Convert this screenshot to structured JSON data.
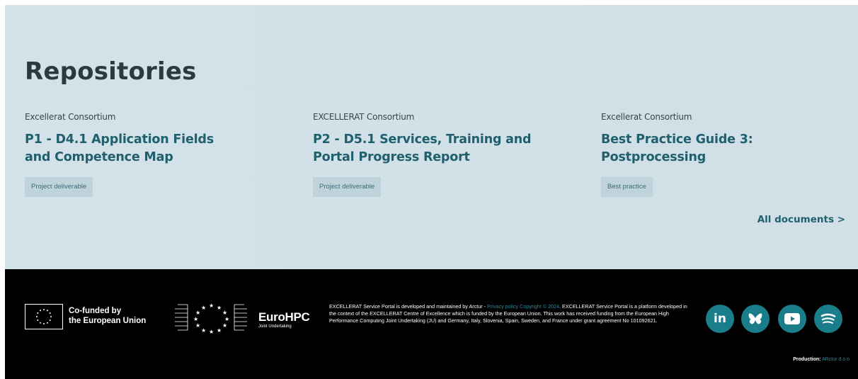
{
  "repositories": {
    "title": "Repositories",
    "cards": [
      {
        "author": "Excellerat Consortium",
        "title": "P1 - D4.1 Application Fields and Competence Map",
        "tag": "Project deliverable"
      },
      {
        "author": "EXCELLERAT Consortium",
        "title": "P2 - D5.1 Services, Training and Portal Progress Report",
        "tag": "Project deliverable"
      },
      {
        "author": "Excellerat Consortium",
        "title": "Best Practice Guide 3: Postprocessing",
        "tag": "Best practice"
      }
    ],
    "all_documents_label": "All documents",
    "all_documents_chevron": ">"
  },
  "footer": {
    "eu_funding": {
      "line1": "Co-funded by",
      "line2": "the European Union"
    },
    "eurohpc": {
      "name": "EuroHPC",
      "subtitle": "Joint Undertaking"
    },
    "text_before": "EXCELLERAT Service Portal is developed and maintained by Arctur - ",
    "privacy_link": "Privacy policy",
    "copyright_link": "Copyright © 2024",
    "text_after": ". EXCELLERAT Service Portal is a platform developed in the context of the EXCELLERAT Centre of Excellence which is funded by the European Union. This work has received funding from the European High Performance Computing Joint Undertaking (JU) and Germany, Italy, Slovenia, Spain, Sweden, and France under grant agreement No 101092621.",
    "social": [
      {
        "icon": "linkedin-icon",
        "label": "in"
      },
      {
        "icon": "bluesky-icon"
      },
      {
        "icon": "youtube-icon"
      },
      {
        "icon": "spotify-icon"
      }
    ],
    "production_label": "Production:",
    "production_link": "ARctur d.o.o"
  },
  "colors": {
    "section_bg": "#d3e2e8",
    "title_text": "#2a3a40",
    "accent_teal": "#1f5f6e",
    "tag_bg": "#bed3da",
    "footer_bg": "#000000",
    "social_bg": "#1a7d8a",
    "link": "#2d8a9a"
  }
}
